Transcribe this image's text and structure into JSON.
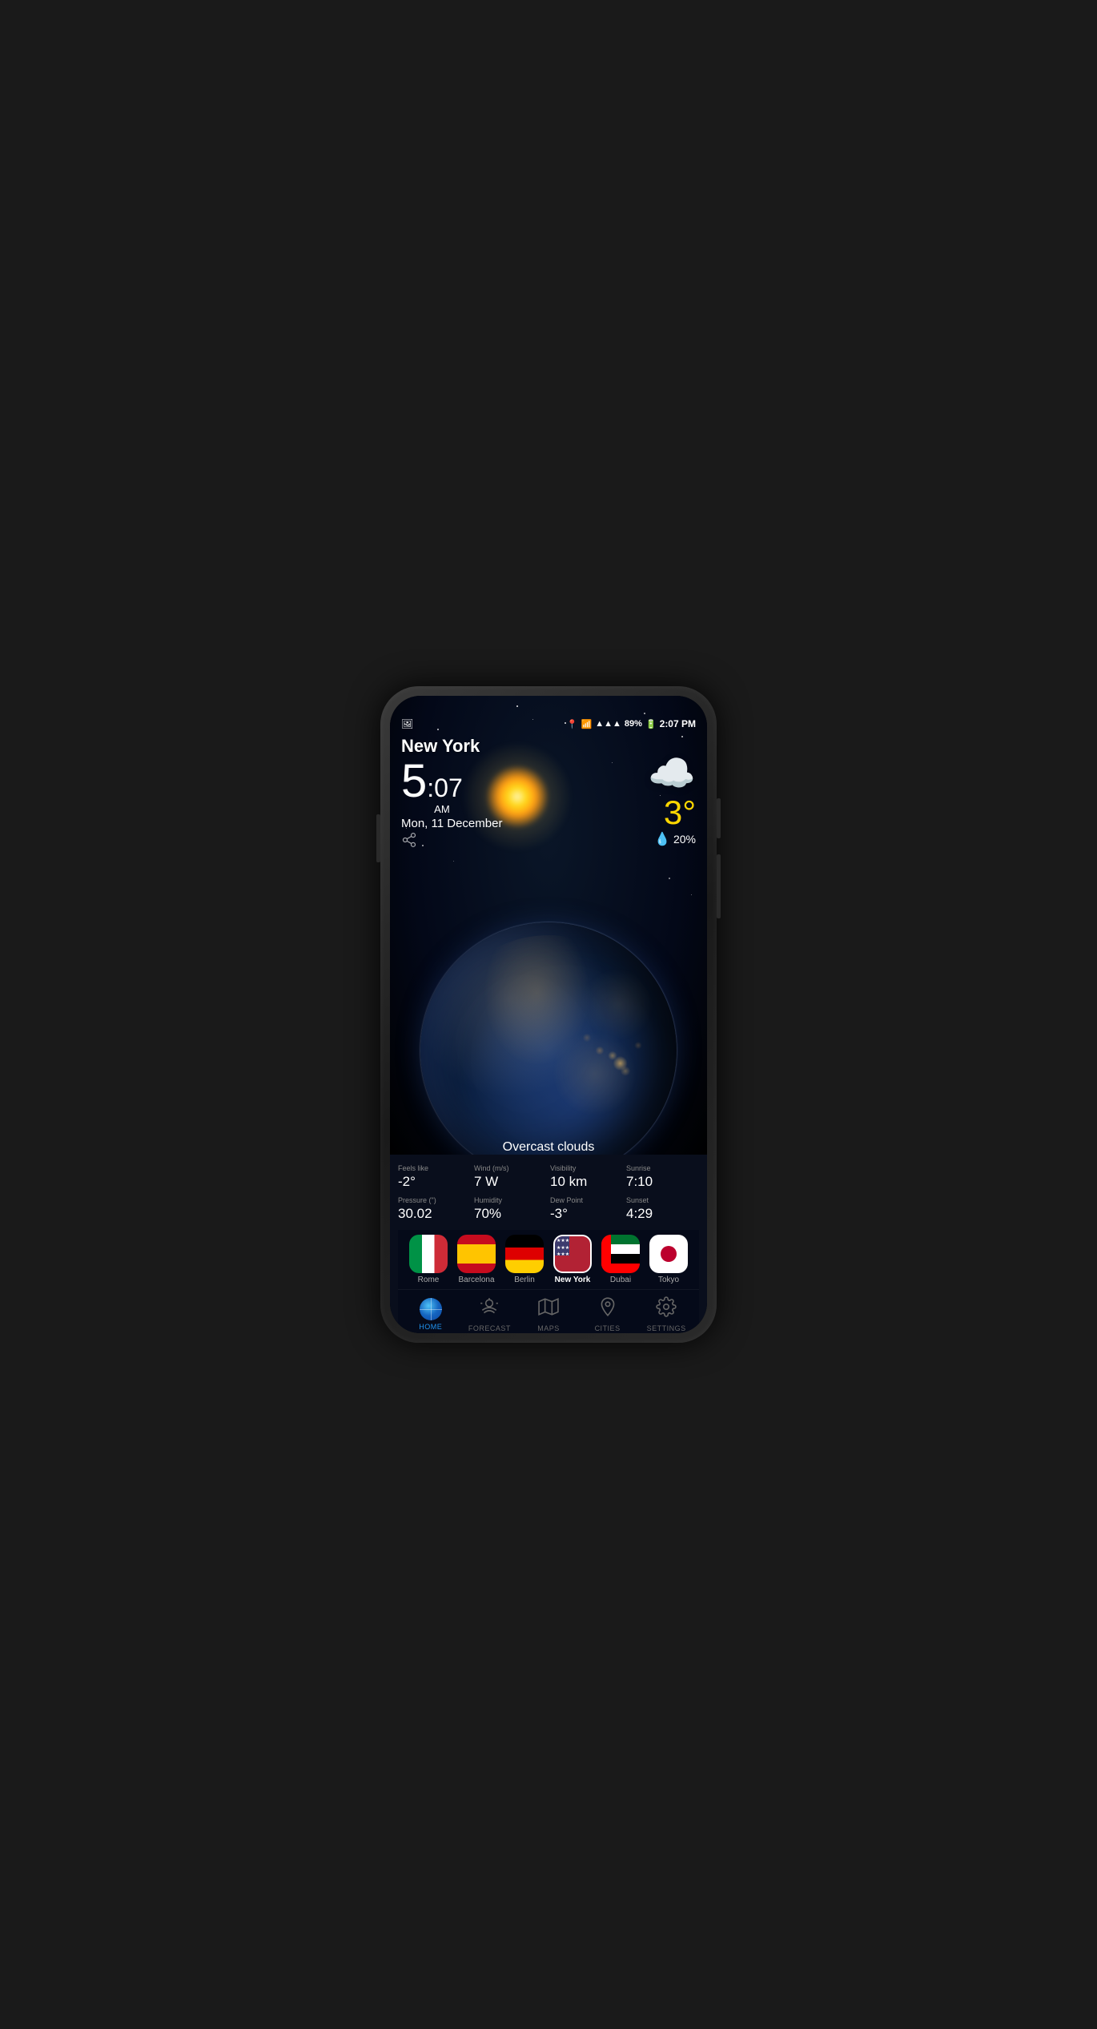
{
  "phone": {
    "statusBar": {
      "time": "2:07 PM",
      "battery": "89%",
      "batteryIcon": "🔋",
      "signal": "📶",
      "wifi": "📡",
      "location": "📍"
    },
    "weather": {
      "city": "New York",
      "timeHour": "5",
      "timeSeparator": ":",
      "timeMinutes": "07",
      "timeAmPm": "AM",
      "date": "Mon, 11 December",
      "temperature": "3°",
      "precipitation": "20%",
      "description": "Overcast clouds",
      "feelsLike": {
        "label": "Feels like",
        "value": "-2°"
      },
      "wind": {
        "label": "Wind (m/s)",
        "value": "7 W"
      },
      "visibility": {
        "label": "Visibility",
        "value": "10 km"
      },
      "sunrise": {
        "label": "Sunrise",
        "value": "7:10"
      },
      "pressure": {
        "label": "Pressure (\")",
        "value": "30.02"
      },
      "humidity": {
        "label": "Humidity",
        "value": "70%"
      },
      "dewPoint": {
        "label": "Dew Point",
        "value": "-3°"
      },
      "sunset": {
        "label": "Sunset",
        "value": "4:29"
      }
    },
    "cities": [
      {
        "name": "Rome",
        "flag": "italy",
        "selected": false
      },
      {
        "name": "Barcelona",
        "flag": "spain",
        "selected": false
      },
      {
        "name": "Berlin",
        "flag": "germany",
        "selected": false
      },
      {
        "name": "New York",
        "flag": "usa",
        "selected": true
      },
      {
        "name": "Dubai",
        "flag": "uae",
        "selected": false
      },
      {
        "name": "Tokyo",
        "flag": "japan",
        "selected": false
      }
    ],
    "nav": [
      {
        "id": "home",
        "label": "HOME",
        "active": true
      },
      {
        "id": "forecast",
        "label": "FORECAST",
        "active": false
      },
      {
        "id": "maps",
        "label": "MAPS",
        "active": false
      },
      {
        "id": "cities",
        "label": "CITIES",
        "active": false
      },
      {
        "id": "settings",
        "label": "SETTINGS",
        "active": false
      }
    ]
  }
}
